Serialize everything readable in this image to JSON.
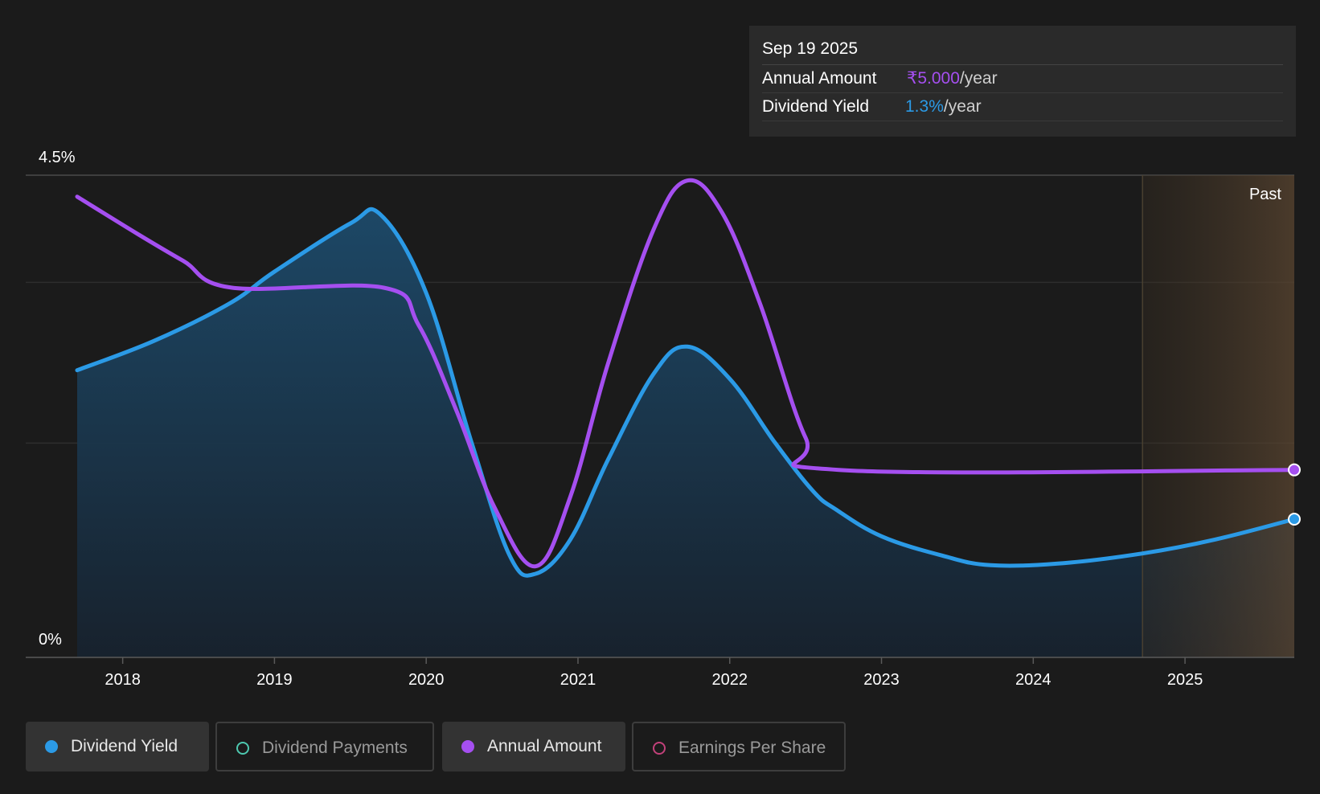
{
  "tooltip": {
    "date": "Sep 19 2025",
    "annual_amount_label": "Annual Amount",
    "annual_amount_value": "₹5.000",
    "annual_amount_unit": "/year",
    "dividend_yield_label": "Dividend Yield",
    "dividend_yield_value": "1.3%",
    "dividend_yield_unit": "/year"
  },
  "legend": [
    {
      "label": "Dividend Yield",
      "active": true,
      "color": "#2b9ae6"
    },
    {
      "label": "Dividend Payments",
      "active": false,
      "color": "#4ec9b0"
    },
    {
      "label": "Annual Amount",
      "active": true,
      "color": "#a54ff0"
    },
    {
      "label": "Earnings Per Share",
      "active": false,
      "color": "#c2417a"
    }
  ],
  "chart_data": {
    "type": "line",
    "y_axis_labels": [
      "4.5%",
      "0%"
    ],
    "ylim": [
      0,
      4.5
    ],
    "xlim": [
      2017.7,
      2025.72
    ],
    "x_ticks": [
      "2018",
      "2019",
      "2020",
      "2021",
      "2022",
      "2023",
      "2024",
      "2025"
    ],
    "past_region_label": "Past",
    "past_region_start": 2024.72,
    "colors": {
      "dividend_yield": "#2b9ae6",
      "annual_amount": "#a54ff0",
      "past_region": "#4a3a26"
    },
    "series": [
      {
        "name": "Dividend Yield",
        "unit": "%",
        "area": true,
        "points": [
          [
            2017.7,
            2.68
          ],
          [
            2018.2,
            2.95
          ],
          [
            2018.7,
            3.3
          ],
          [
            2019.0,
            3.6
          ],
          [
            2019.5,
            4.05
          ],
          [
            2019.7,
            4.13
          ],
          [
            2020.0,
            3.4
          ],
          [
            2020.3,
            2.0
          ],
          [
            2020.55,
            0.95
          ],
          [
            2020.72,
            0.78
          ],
          [
            2020.95,
            1.1
          ],
          [
            2021.2,
            1.85
          ],
          [
            2021.5,
            2.65
          ],
          [
            2021.72,
            2.9
          ],
          [
            2022.0,
            2.6
          ],
          [
            2022.3,
            2.0
          ],
          [
            2022.55,
            1.55
          ],
          [
            2022.7,
            1.38
          ],
          [
            2023.0,
            1.13
          ],
          [
            2023.4,
            0.95
          ],
          [
            2023.72,
            0.86
          ],
          [
            2024.2,
            0.88
          ],
          [
            2024.72,
            0.97
          ],
          [
            2025.2,
            1.1
          ],
          [
            2025.72,
            1.29
          ]
        ]
      },
      {
        "name": "Annual Amount",
        "unit": "₹",
        "area": false,
        "points": [
          [
            2017.7,
            4.3
          ],
          [
            2018.1,
            3.95
          ],
          [
            2018.4,
            3.7
          ],
          [
            2018.72,
            3.45
          ],
          [
            2019.72,
            3.45
          ],
          [
            2019.95,
            3.1
          ],
          [
            2020.2,
            2.3
          ],
          [
            2020.45,
            1.4
          ],
          [
            2020.72,
            0.85
          ],
          [
            2020.95,
            1.5
          ],
          [
            2021.2,
            2.75
          ],
          [
            2021.5,
            4.0
          ],
          [
            2021.72,
            4.45
          ],
          [
            2021.95,
            4.15
          ],
          [
            2022.2,
            3.3
          ],
          [
            2022.5,
            2.05
          ],
          [
            2022.72,
            1.75
          ],
          [
            2025.72,
            1.75
          ]
        ]
      }
    ]
  }
}
